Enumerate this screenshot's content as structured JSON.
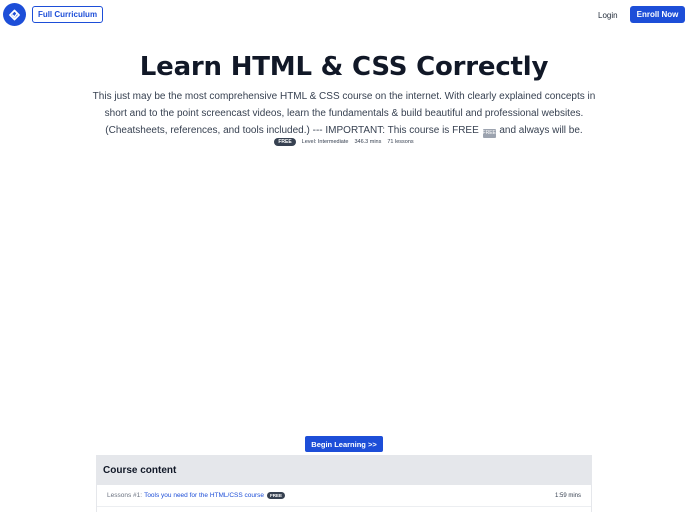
{
  "header": {
    "curriculum_button": "Full Curriculum",
    "login_link": "Login",
    "enroll_button": "Enroll Now"
  },
  "hero": {
    "title": "Learn HTML & CSS Correctly",
    "description_before": "This just may be the most comprehensive HTML & CSS course on the internet. With clearly explained concepts in short and to the point screencast videos, learn the fundamentals & build beautiful and professional websites. (Cheatsheets, references, and tools included.) --- IMPORTANT: This course is FREE",
    "description_free_glyph": "FREE",
    "description_after": "and always will be.",
    "badge": "FREE",
    "level": "Level: Intermediate",
    "duration": "346.3 mins",
    "lessons": "71 lessons"
  },
  "begin_button": "Begin Learning >>",
  "course_content": {
    "title": "Course content",
    "lessons": [
      {
        "prefix": "Lessons #1:",
        "title": "Tools you need for the HTML/CSS course",
        "badge": "FREE",
        "duration": "1:59 mins"
      }
    ]
  },
  "colors": {
    "accent": "#1d4ed8",
    "badge_bg": "#374151",
    "header_bg": "#e5e7eb"
  }
}
